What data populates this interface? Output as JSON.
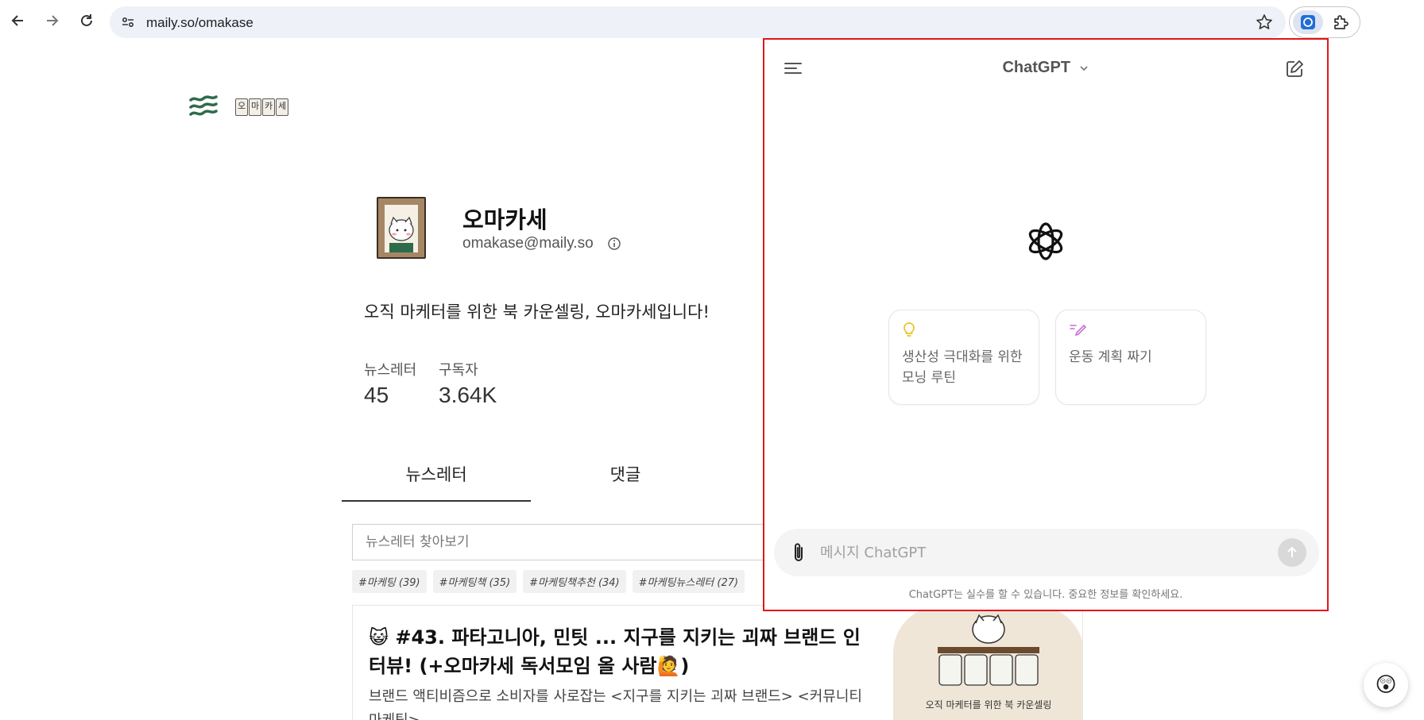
{
  "browser": {
    "url": "maily.so/omakase"
  },
  "page": {
    "logo_box_chars": [
      "오",
      "마",
      "카",
      "세"
    ],
    "profile": {
      "name": "오마카세",
      "email": "omakase@maily.so"
    },
    "bio": "오직 마케터를 위한 북 카운셀링, 오마카세입니다!",
    "stats": [
      {
        "label": "뉴스레터",
        "value": "45"
      },
      {
        "label": "구독자",
        "value": "3.64K"
      }
    ],
    "tabs": [
      {
        "label": "뉴스레터",
        "active": true
      },
      {
        "label": "댓글",
        "active": false
      }
    ],
    "search_placeholder": "뉴스레터 찾아보기",
    "tags": [
      "#마케팅 (39)",
      "#마케팅책 (35)",
      "#마케팅책추천 (34)",
      "#마케팅뉴스레터 (27)"
    ],
    "article": {
      "title": "😺 #43. 파타고니아, 민팃 ... 지구를 지키는 괴짜 브랜드 인터뷰! (+오마카세 독서모임 올 사람🙋)",
      "description": "브랜드 액티비즘으로 소비자를 사로잡는 <지구를 지키는 괴짜 브랜드> <커뮤니티 마케팅>",
      "thumb_sign": "오마카세",
      "thumb_caption": "오직 마케터를 위한 북 카운셀링"
    },
    "float_button_icon": "😲"
  },
  "chatgpt": {
    "title": "ChatGPT",
    "suggestions": [
      {
        "icon": "lightbulb-icon",
        "icon_color": "#e8c21c",
        "text": "생산성 극대화를 위한 모닝 루틴"
      },
      {
        "icon": "pencil-scribble-icon",
        "icon_color": "#c86fd6",
        "text": "운동 계획 짜기"
      }
    ],
    "input_placeholder": "메시지 ChatGPT",
    "disclaimer": "ChatGPT는 실수를 할 수 있습니다. 중요한 정보를 확인하세요."
  },
  "colors": {
    "panel_border": "#e4141b",
    "omnibox_bg": "#eef1f8",
    "logo_green": "#2e6b4a"
  }
}
